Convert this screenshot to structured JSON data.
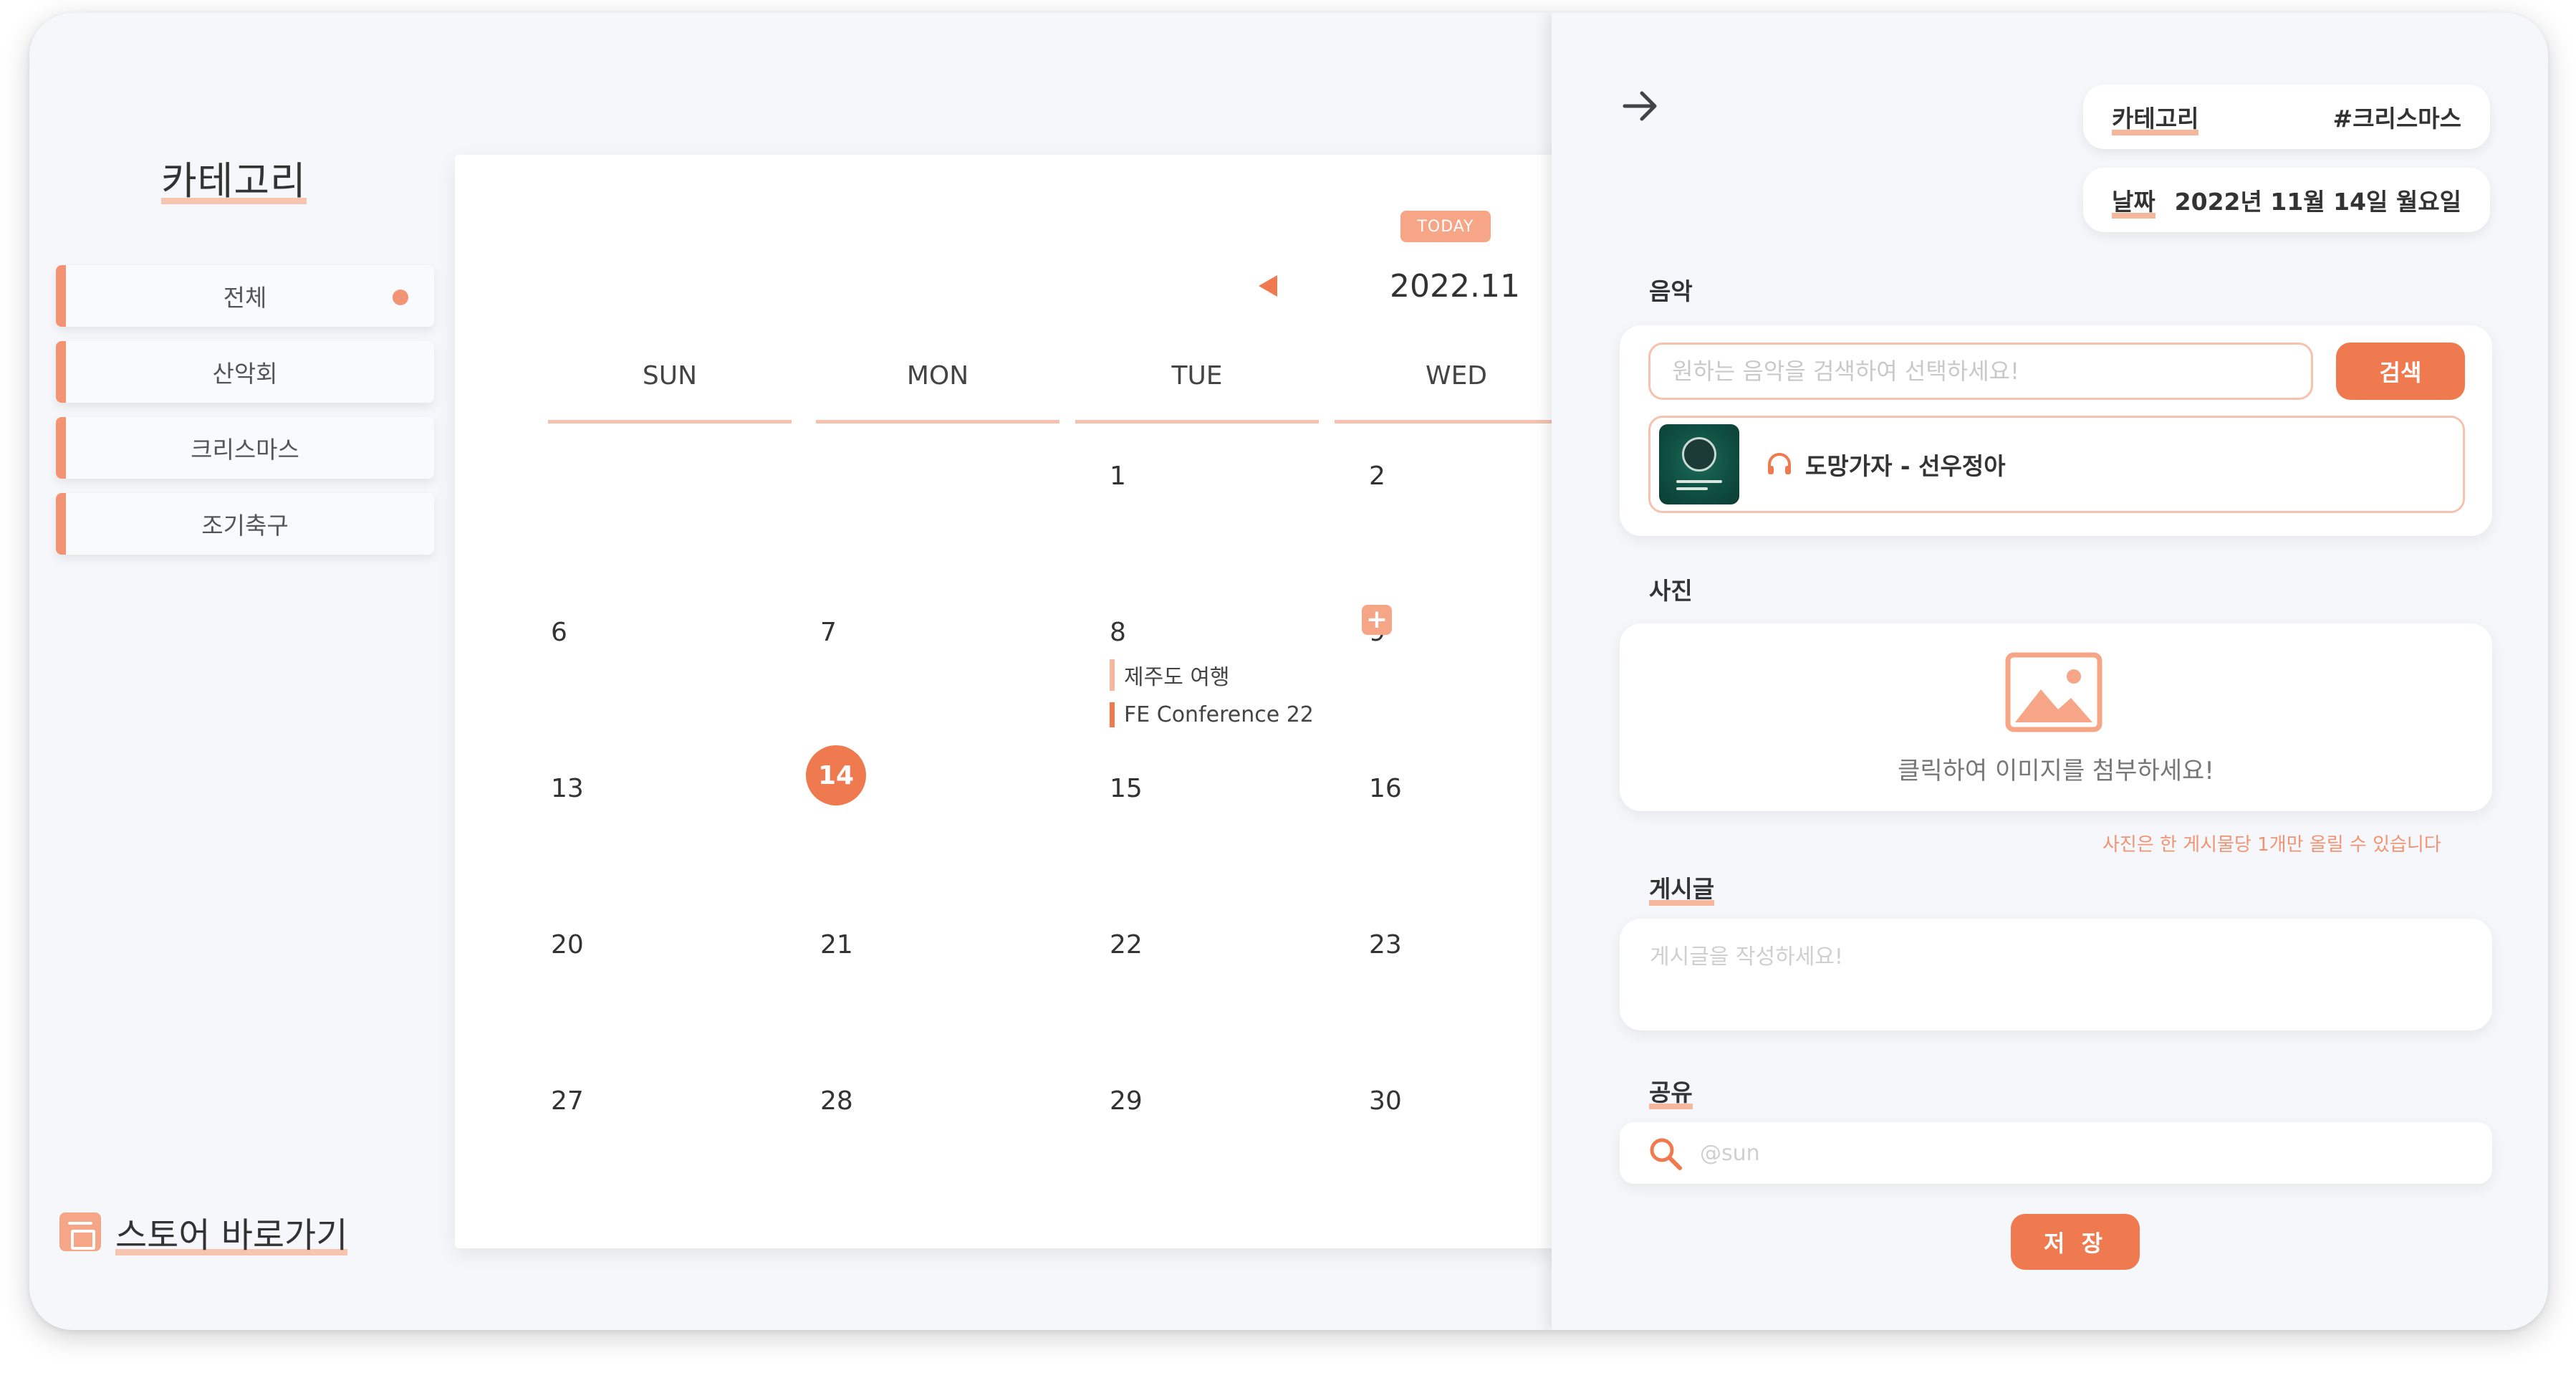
{
  "sidebar": {
    "title": "카테고리",
    "items": [
      {
        "label": "전체",
        "active": true
      },
      {
        "label": "산악회"
      },
      {
        "label": "크리스마스"
      },
      {
        "label": "조기축구"
      }
    ],
    "store_link": "스토어 바로가기",
    "store_icon": "store-icon"
  },
  "calendar": {
    "today_badge": "TODAY",
    "month": "2022.11",
    "weekdays": [
      "SUN",
      "MON",
      "TUE",
      "WED"
    ],
    "rows": [
      [
        "",
        "",
        "1",
        "2"
      ],
      [
        "6",
        "7",
        "8",
        "9"
      ],
      [
        "13",
        "14",
        "15",
        "16"
      ],
      [
        "20",
        "21",
        "22",
        "23"
      ],
      [
        "27",
        "28",
        "29",
        "30"
      ]
    ],
    "today": "14",
    "events": [
      {
        "day": "8",
        "title": "제주도 여행"
      },
      {
        "day": "8",
        "title": "FE Conference 22"
      }
    ],
    "add_button": "+"
  },
  "panel": {
    "category_key": "카테고리",
    "category_value": "#크리스마스",
    "date_key": "날짜",
    "date_value": "2022년 11월 14일 월요일",
    "music_label": "음악",
    "music_placeholder": "원하는 음악을 검색하여 선택하세요!",
    "search_button": "검색",
    "track_title": "도망가자 - 선우정아",
    "photo_label": "사진",
    "photo_prompt": "클릭하여 이미지를 첨부하세요!",
    "photo_note": "사진은 한 게시물당 1개만 올릴 수 있습니다",
    "post_label": "게시글",
    "post_placeholder": "게시글을 작성하세요!",
    "share_label": "공유",
    "share_placeholder": "@sun",
    "save_button": "저 장"
  },
  "colors": {
    "accent": "#f07a50",
    "accent_light": "#f6a586",
    "highlight": "#f6b79c",
    "background": "#f6f7fb"
  }
}
